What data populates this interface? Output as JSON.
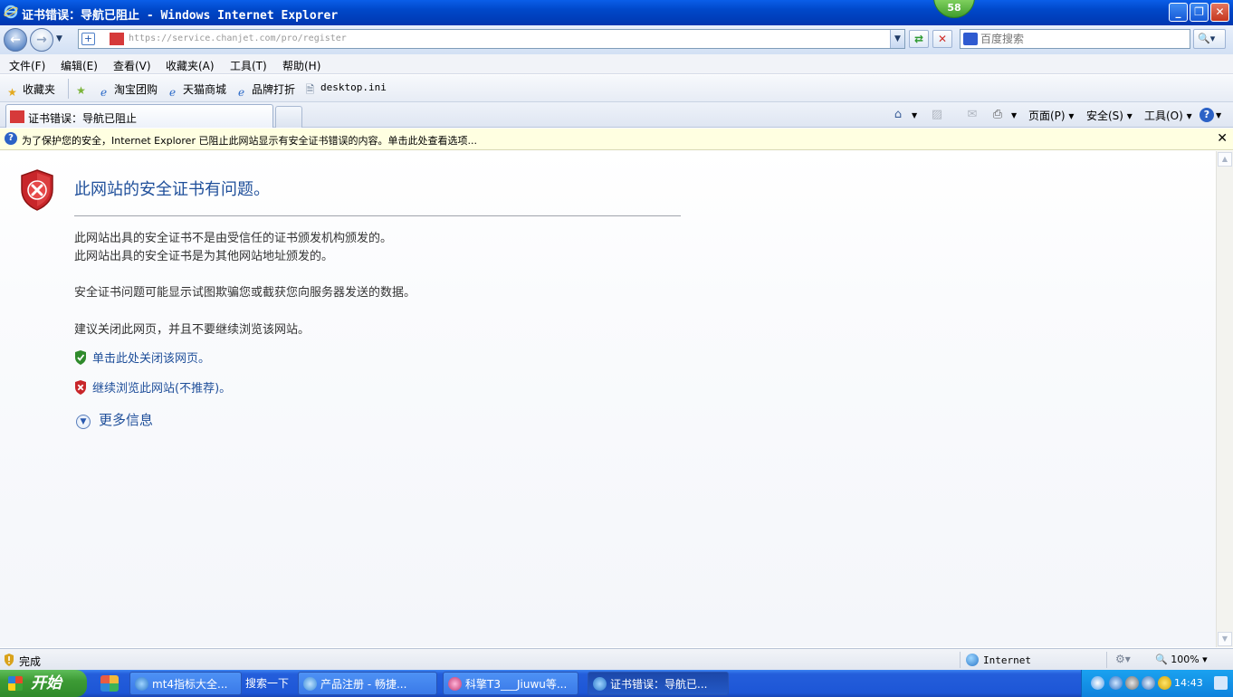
{
  "window": {
    "title": "证书错误：导航已阻止 - Windows Internet Explorer",
    "badge": "58",
    "minimize": "_",
    "maximize": "❐",
    "close": "✕"
  },
  "address": {
    "url": "https://service.chanjet.com/pro/register",
    "search_placeholder": "百度搜索"
  },
  "menu": [
    "文件(F)",
    "编辑(E)",
    "查看(V)",
    "收藏夹(A)",
    "工具(T)",
    "帮助(H)"
  ],
  "favorites": {
    "label": "收藏夹",
    "items": [
      "淘宝团购",
      "天猫商城",
      "品牌打折",
      "desktop.ini"
    ]
  },
  "tab": {
    "label": "证书错误：导航已阻止"
  },
  "commandbar": {
    "page": "页面(P)",
    "safety": "安全(S)",
    "tools": "工具(O)"
  },
  "infobar": {
    "text": "为了保护您的安全，Internet Explorer 已阻止此网站显示有安全证书错误的内容。单击此处查看选项..."
  },
  "error": {
    "title": "此网站的安全证书有问题。",
    "line1": "此网站出具的安全证书不是由受信任的证书颁发机构颁发的。",
    "line2": "此网站出具的安全证书是为其他网站地址颁发的。",
    "line3": "安全证书问题可能显示试图欺骗您或截获您向服务器发送的数据。",
    "line4": "建议关闭此网页，并且不要继续浏览该网站。",
    "close_link": "单击此处关闭该网页。",
    "continue_link": "继续浏览此网站(不推荐)。",
    "more_info": "更多信息"
  },
  "status": {
    "text": "完成",
    "zone": "Internet",
    "zoom": "100%"
  },
  "taskbar": {
    "start": "开始",
    "tasks": [
      "mt4指标大全...",
      "搜索一下",
      "产品注册 - 畅捷...",
      "科擎T3___Jiuwu等...",
      "证书错误：导航已..."
    ],
    "clock": "14:43"
  },
  "colors": {
    "link": "#1f4f9a",
    "error_red": "#c8262a",
    "ok_green": "#2f8a2b",
    "titlebar": "#0047c8"
  }
}
